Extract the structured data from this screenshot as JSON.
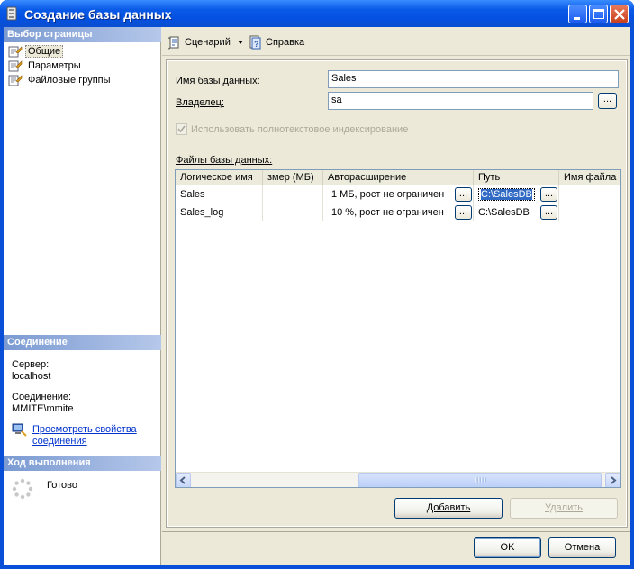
{
  "window": {
    "title": "Создание базы данных"
  },
  "left": {
    "pages_header": "Выбор страницы",
    "pages": [
      {
        "label": "Общие",
        "selected": true
      },
      {
        "label": "Параметры",
        "selected": false
      },
      {
        "label": "Файловые группы",
        "selected": false
      }
    ],
    "connection_header": "Соединение",
    "server_label": "Сервер:",
    "server_value": "localhost",
    "connection_label": "Соединение:",
    "connection_value": "MMITE\\mmite",
    "link_line1": "Просмотреть свойства",
    "link_line2": "соединения",
    "progress_header": "Ход выполнения",
    "progress_status": "Готово"
  },
  "toolbar": {
    "script_label": "Сценарий",
    "help_label": "Справка"
  },
  "form": {
    "db_name_label": "Имя базы данных:",
    "db_name_value": "Sales",
    "owner_label": "Владелец:",
    "owner_value": "sa",
    "fulltext_label": "Использовать полнотекстовое индексирование",
    "files_label": "Файлы базы данных:"
  },
  "grid": {
    "columns": [
      "Логическое имя",
      "змер (МБ)",
      "Авторасширение",
      "Путь",
      "Имя файла"
    ],
    "rows": [
      {
        "name": "Sales",
        "size": "",
        "autogrowth": "1 МБ, рост не ограничен",
        "path": "C:\\SalesDB"
      },
      {
        "name": "Sales_log",
        "size": "",
        "autogrowth": "10 %, рост не ограничен",
        "path": "C:\\SalesDB"
      }
    ],
    "dots": "..."
  },
  "buttons": {
    "add": "Добавить",
    "remove": "Удалить",
    "ok": "OK",
    "cancel": "Отмена"
  },
  "colors": {
    "titlebar": "#0a5ae8",
    "section_header": "#7a9ad2",
    "link": "#0033cc",
    "selection": "#316ac5"
  }
}
